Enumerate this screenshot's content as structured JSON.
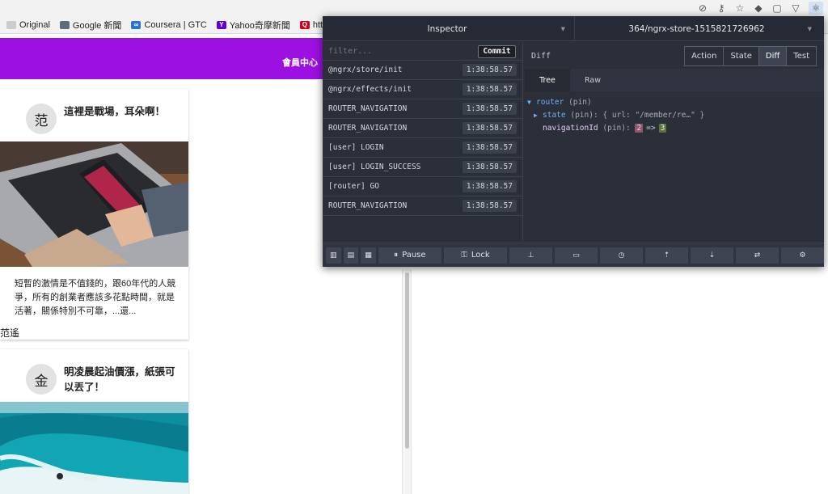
{
  "browser": {
    "bookmarks": [
      {
        "label": "Original",
        "icon": "folder-icon",
        "color": "#c9ccd1"
      },
      {
        "label": "Google 新聞",
        "icon": "news-icon",
        "color": "#5f6b7a"
      },
      {
        "label": "Coursera | GTC",
        "icon": "coursera-icon",
        "color": "#2a73cc"
      },
      {
        "label": "Yahoo奇摩新聞",
        "icon": "yahoo-icon",
        "color": "#6001d2"
      },
      {
        "label": "https://ww",
        "icon": "quora-icon",
        "color": "#d0021b"
      }
    ],
    "toolbar_icons": [
      "block-icon",
      "key-icon",
      "star-icon",
      "evernote-icon",
      "extension-icon",
      "extension-icon",
      "redux-icon"
    ]
  },
  "site": {
    "header_color": "#9c10e2",
    "member_link": "會員中心"
  },
  "posts": [
    {
      "avatar": "范",
      "title": "這裡是戰場，耳朵啊！",
      "excerpt": "短暫的激情是不值錢的，跟60年代的人競爭，所有的創業者應該多花點時間，就是活著，關係特別不可靠，...還...",
      "author": "范遙",
      "image": "phone-laptop-photo"
    },
    {
      "avatar": "金",
      "title": "明凌晨起油價漲，紙張可以丟了！",
      "image": "surfer-wave-photo"
    }
  ],
  "devtools": {
    "monitor": "Inspector",
    "store": "364/ngrx-store-1515821726962",
    "filter_placeholder": "filter...",
    "commit": "Commit",
    "actions": [
      {
        "name": "@ngrx/store/init",
        "time": "1:38:58.57"
      },
      {
        "name": "@ngrx/effects/init",
        "time": "1:38:58.57"
      },
      {
        "name": "ROUTER_NAVIGATION",
        "time": "1:38:58.57"
      },
      {
        "name": "ROUTER_NAVIGATION",
        "time": "1:38:58.57"
      },
      {
        "name": "[user] LOGIN",
        "time": "1:38:58.57"
      },
      {
        "name": "[user] LOGIN_SUCCESS",
        "time": "1:38:58.57"
      },
      {
        "name": "[router] GO",
        "time": "1:38:58.57"
      },
      {
        "name": "ROUTER_NAVIGATION",
        "time": "1:38:58.57"
      }
    ],
    "diff_label": "Diff",
    "tabs": [
      "Action",
      "State",
      "Diff",
      "Test"
    ],
    "active_tab": "Diff",
    "subtabs": [
      "Tree",
      "Raw"
    ],
    "active_subtab": "Tree",
    "tree": {
      "root_key": "router",
      "root_pin": "(pin)",
      "state_key": "state",
      "state_pin": "(pin):",
      "state_value": "{ url: \"/member/re…\" }",
      "nav_key": "navigationId",
      "nav_pin": "(pin):",
      "nav_old": "2",
      "nav_arrow": "=>",
      "nav_new": "3"
    },
    "bottom": {
      "pause": "Pause",
      "lock": "Lock",
      "icons": [
        "layout-left-icon",
        "layout-bottom-icon",
        "layout-right-icon",
        "pin-icon",
        "keyboard-icon",
        "timer-icon",
        "upload-icon",
        "download-icon",
        "remote-icon",
        "settings-icon"
      ]
    }
  }
}
